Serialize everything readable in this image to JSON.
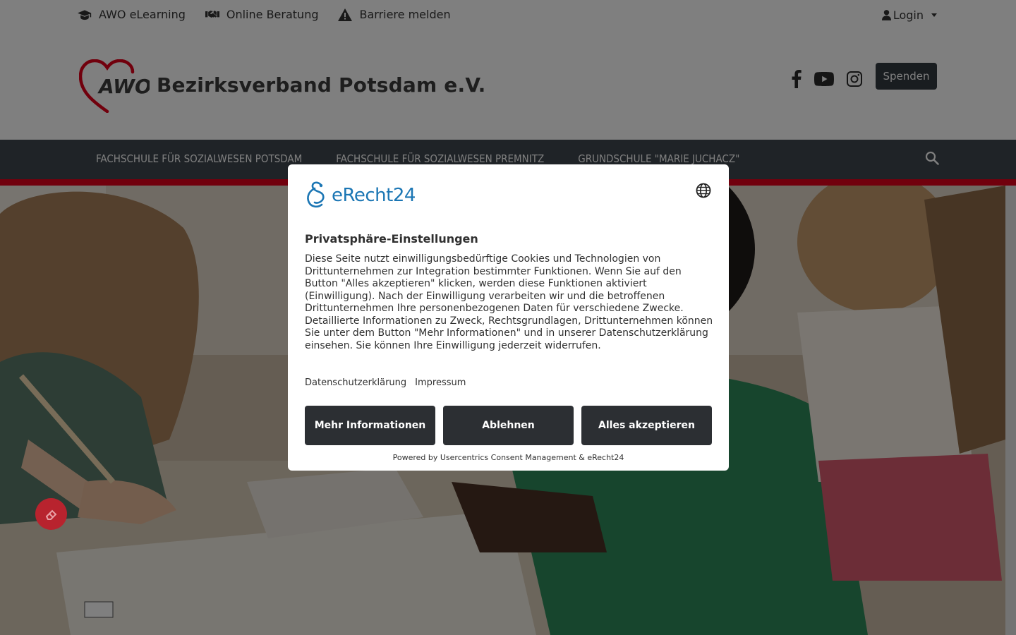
{
  "topbar": {
    "links": [
      {
        "label": "AWO eLearning",
        "icon": "graduation-cap-icon"
      },
      {
        "label": "Online Beratung",
        "icon": "handshake-icon"
      },
      {
        "label": "Barriere melden",
        "icon": "warning-icon"
      }
    ],
    "login_label": "Login"
  },
  "header": {
    "logo_text": "AWO",
    "brand_name": "Bezirksverband Potsdam e.V.",
    "socials": [
      "facebook-icon",
      "youtube-icon",
      "instagram-icon"
    ],
    "donate_label": "Spenden"
  },
  "nav": {
    "items": [
      {
        "label": "FACHSCHULE FÜR SOZIALWESEN POTSDAM"
      },
      {
        "label": "FACHSCHULE FÜR SOZIALWESEN PREMNITZ"
      },
      {
        "label": "GRUNDSCHULE \"MARIE JUCHACZ\""
      }
    ]
  },
  "consent": {
    "brand": "eRecht24",
    "title": "Privatsphäre-Einstellungen",
    "body": "Diese Seite nutzt einwilligungsbedürftige Cookies und Technologien von Drittunternehmen zur Integration bestimmter Funktionen. Wenn Sie auf den Button \"Alles akzeptieren\" klicken, werden diese Funktionen aktiviert (Einwilligung). Nach der Einwilligung verarbeiten wir und die betroffenen Drittunternehmen Ihre personenbezogenen Daten für verschiedene Zwecke. Detaillierte Informationen zu Zweck, Rechtsgrundlagen, Drittunternehmen können Sie unter dem Button \"Mehr Informationen\" und in unserer Datenschutzerklärung einsehen. Sie können Ihre Einwilligung jederzeit widerrufen.",
    "link_privacy": "Datenschutzerklärung",
    "link_imprint": "Impressum",
    "btn_more": "Mehr Informationen",
    "btn_decline": "Ablehnen",
    "btn_accept": "Alles akzeptieren",
    "powered_by": "Powered by Usercentrics Consent Management & eRecht24"
  },
  "colors": {
    "nav_bg": "#3f474e",
    "accent_red": "#e2001a",
    "button_dark": "#2c2f33",
    "erecht_blue": "#1b76b4"
  }
}
